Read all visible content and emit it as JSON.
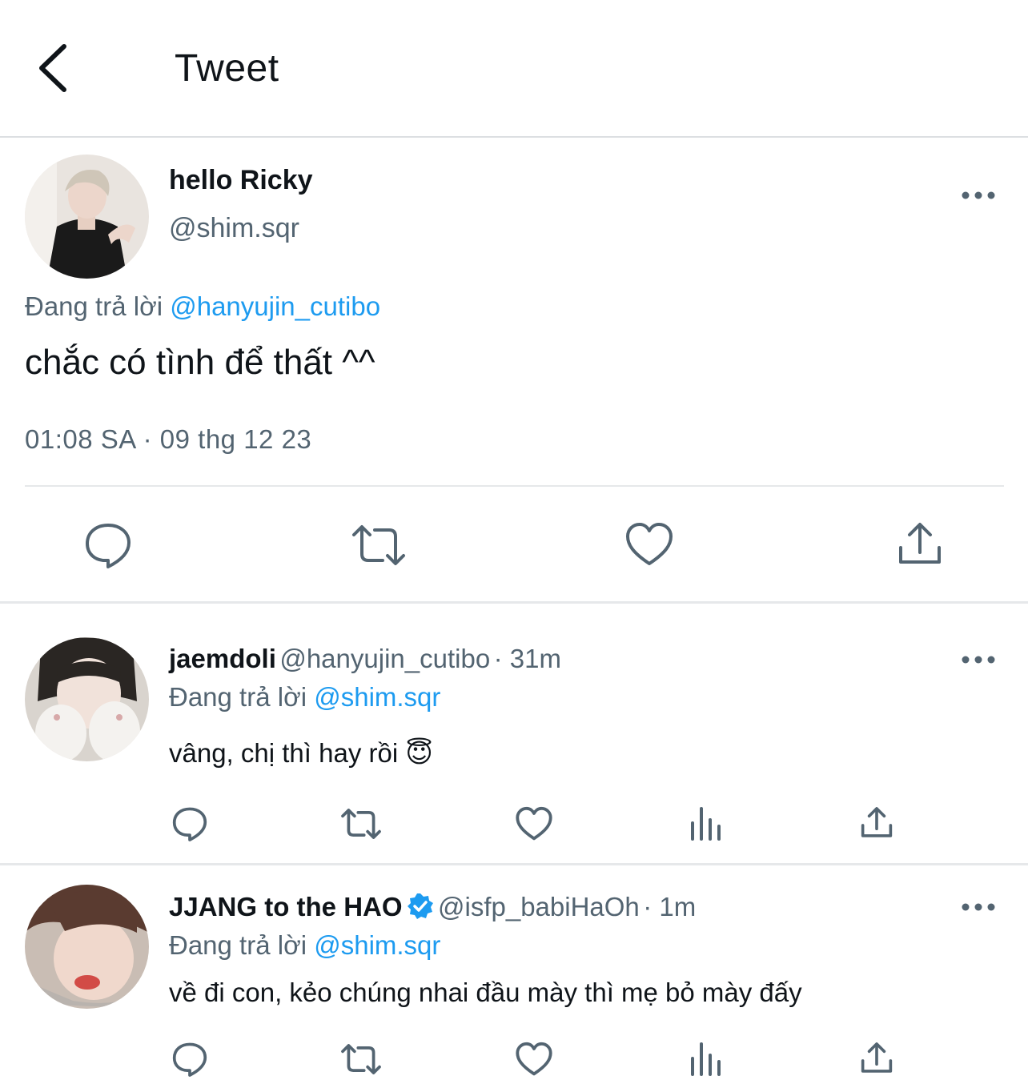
{
  "header": {
    "title": "Tweet"
  },
  "main_tweet": {
    "name": "hello Ricky",
    "handle": "@shim.sqr",
    "replying_prefix": "Đang trả lời",
    "replying_to": "@hanyujin_cutibo",
    "text": "chắc có tình để thất ^^",
    "timestamp": "01:08 SA · 09 thg 12 23"
  },
  "replies": [
    {
      "name": "jaemdoli",
      "handle": "@hanyujin_cutibo",
      "time": "· 31m",
      "replying_prefix": "Đang trả lời",
      "replying_to": "@shim.sqr",
      "text": "vâng, chị thì hay rồi 😇"
    },
    {
      "name": "JJANG to the HAO",
      "verified": true,
      "handle": "@isfp_babiHaOh",
      "time": "· 1m",
      "replying_prefix": "Đang trả lời",
      "replying_to": "@shim.sqr",
      "text": "về đi con, kẻo chúng nhai đầu mày thì mẹ bỏ mày đấy"
    }
  ],
  "colors": {
    "accent": "#1d9bf0",
    "icon_gray": "#536471",
    "divider": "#e6e8ea"
  }
}
